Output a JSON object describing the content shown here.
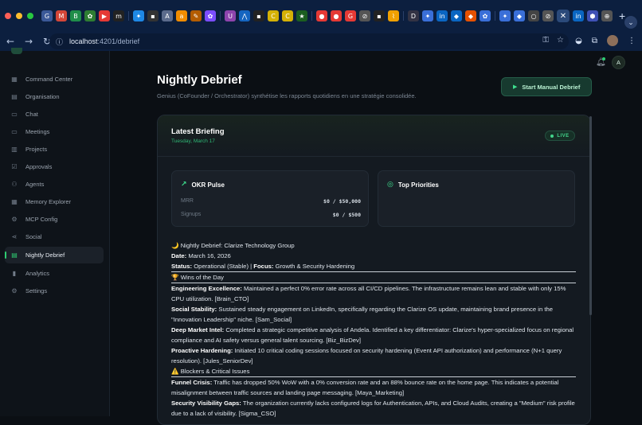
{
  "browser": {
    "url_host": "localhost",
    "url_path": ":4201/debrief",
    "tab_icons": [
      "G",
      "M",
      "B",
      "✿",
      "▶",
      "m",
      "✦",
      "▪",
      "A",
      "a",
      "✎",
      "✿",
      "U",
      "⋀",
      "▪",
      "C",
      "C",
      "★",
      "●",
      "●",
      "G",
      "⊘",
      "▪",
      "⌇",
      "D",
      "✦",
      "in",
      "◆",
      "◆",
      "✿",
      "✦",
      "◆",
      "○",
      "⊘"
    ],
    "active_tab_glyph": "✕",
    "right_tab_icons": [
      "in",
      "⬢",
      "⊕"
    ]
  },
  "topbar": {
    "avatar_initial": "A"
  },
  "sidebar": {
    "items": [
      {
        "label": "Command Center",
        "icon": "grid-icon",
        "glyph": "▦"
      },
      {
        "label": "Organisation",
        "icon": "building-icon",
        "glyph": "▤"
      },
      {
        "label": "Chat",
        "icon": "chat-icon",
        "glyph": "▭"
      },
      {
        "label": "Meetings",
        "icon": "video-icon",
        "glyph": "▭"
      },
      {
        "label": "Projects",
        "icon": "folder-icon",
        "glyph": "▥"
      },
      {
        "label": "Approvals",
        "icon": "check-square-icon",
        "glyph": "☑"
      },
      {
        "label": "Agents",
        "icon": "users-icon",
        "glyph": "⚇"
      },
      {
        "label": "Memory Explorer",
        "icon": "database-icon",
        "glyph": "▦"
      },
      {
        "label": "MCP Config",
        "icon": "gear-icon",
        "glyph": "⚙"
      },
      {
        "label": "Social",
        "icon": "share-icon",
        "glyph": "⋖"
      },
      {
        "label": "Nightly Debrief",
        "icon": "document-icon",
        "glyph": "▤"
      },
      {
        "label": "Analytics",
        "icon": "bar-chart-icon",
        "glyph": "▮"
      },
      {
        "label": "Settings",
        "icon": "gear-icon",
        "glyph": "⚙"
      }
    ],
    "active_index": 10
  },
  "header": {
    "title": "Nightly Debrief",
    "subtitle": "Genius (CoFounder / Orchestrator) synthétise les rapports quotidiens en une stratégie consolidée.",
    "start_button": "Start Manual Debrief"
  },
  "briefing": {
    "title": "Latest Briefing",
    "date": "Tuesday, March 17",
    "live_label": "LIVE",
    "okr": {
      "title": "OKR Pulse",
      "rows": [
        {
          "key": "MRR",
          "value": "$0 / $50,000"
        },
        {
          "key": "Signups",
          "value": "$0 / $500"
        }
      ]
    },
    "priorities": {
      "title": "Top Priorities"
    }
  },
  "report": {
    "heading": "🌙 Nightly Debrief: Clarize Technology Group",
    "date_label": "Date:",
    "date_value": "March 16, 2026",
    "status_label": "Status:",
    "status_value": "Operational (Stable) |",
    "focus_label": "Focus:",
    "focus_value": "Growth & Security Hardening",
    "wins_heading": "🏆 Wins of the Day",
    "wins": [
      {
        "label": "Engineering Excellence:",
        "text": "Maintained a perfect 0% error rate across all CI/CD pipelines. The infrastructure remains lean and stable with only 15% CPU utilization. [Brain_CTO]"
      },
      {
        "label": "Social Stability:",
        "text": "Sustained steady engagement on LinkedIn, specifically regarding the Clarize OS update, maintaining brand presence in the \"Innovation Leadership\" niche. [Sam_Social]"
      },
      {
        "label": "Deep Market Intel:",
        "text": "Completed a strategic competitive analysis of Andela. Identified a key differentiator: Clarize's hyper-specialized focus on regional compliance and AI safety versus general talent sourcing. [Biz_BizDev]"
      },
      {
        "label": "Proactive Hardening:",
        "text": "Initiated 10 critical coding sessions focused on security hardening (Event API authorization) and performance (N+1 query resolution). [Jules_SeniorDev]"
      }
    ],
    "blockers_heading": "⚠️ Blockers & Critical Issues",
    "blockers": [
      {
        "label": "Funnel Crisis:",
        "text": "Traffic has dropped 50% WoW with a 0% conversion rate and an 88% bounce rate on the home page. This indicates a potential misalignment between traffic sources and landing page messaging. [Maya_Marketing]"
      },
      {
        "label": "Security Visibility Gaps:",
        "text": "The organization currently lacks configured logs for Authentication, APIs, and Cloud Audits, creating a \"Medium\" risk profile due to a lack of visibility. [Sigma_CSO]"
      }
    ]
  }
}
